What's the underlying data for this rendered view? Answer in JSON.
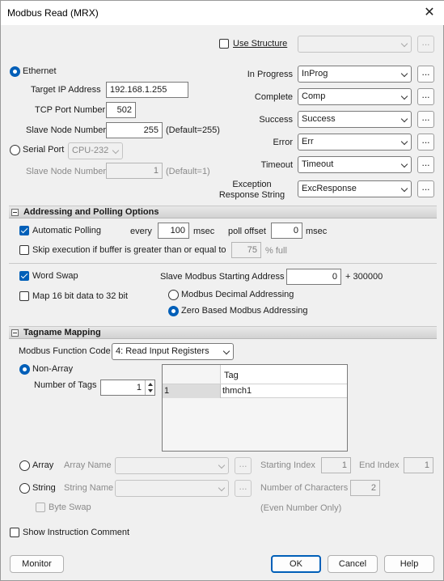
{
  "window": {
    "title": "Modbus Read (MRX)",
    "close_glyph": "✕"
  },
  "structure": {
    "use_label": "Use Structure",
    "value": ""
  },
  "ethernet": {
    "label": "Ethernet",
    "target_ip_label": "Target IP Address",
    "target_ip": "192.168.1.255",
    "tcp_port_label": "TCP Port Number",
    "tcp_port": "502",
    "slave_node_label": "Slave Node Number",
    "slave_node": "255",
    "slave_default": "(Default=255)"
  },
  "serial": {
    "label": "Serial Port",
    "port": "CPU-232",
    "slave_node_label": "Slave Node Number",
    "slave_node": "1",
    "slave_default": "(Default=1)"
  },
  "status_bits": [
    {
      "label": "In Progress",
      "value": "InProg"
    },
    {
      "label": "Complete",
      "value": "Comp"
    },
    {
      "label": "Success",
      "value": "Success"
    },
    {
      "label": "Error",
      "value": "Err"
    },
    {
      "label": "Timeout",
      "value": "Timeout"
    },
    {
      "label": "Exception\nResponse String",
      "value": "ExcResponse"
    }
  ],
  "addressing": {
    "section_title": "Addressing and Polling Options",
    "auto_polling_label": "Automatic Polling",
    "every_label": "every",
    "every_value": "100",
    "every_unit": "msec",
    "poll_offset_label": "poll offset",
    "poll_offset_value": "0",
    "poll_offset_unit": "msec",
    "skip_label": "Skip execution if buffer is greater than or equal to",
    "skip_value": "75",
    "skip_unit": "% full",
    "word_swap_label": "Word Swap",
    "map_label": "Map 16 bit data to 32 bit",
    "slave_start_label": "Slave Modbus Starting Address",
    "slave_start_value": "0",
    "slave_start_suffix": "+ 300000",
    "decimal_label": "Modbus Decimal Addressing",
    "zero_based_label": "Zero Based Modbus Addressing"
  },
  "tagname": {
    "section_title": "Tagname Mapping",
    "function_code_label": "Modbus Function Code",
    "function_code": "4: Read Input Registers",
    "non_array_label": "Non-Array",
    "num_tags_label": "Number of Tags",
    "num_tags": "1",
    "grid_header": "Tag",
    "grid_row_index": "1",
    "grid_row_tag": "thmch1",
    "array_label": "Array",
    "array_name_label": "Array Name",
    "starting_index_label": "Starting Index",
    "starting_index": "1",
    "end_index_label": "End Index",
    "end_index": "1",
    "string_label": "String",
    "string_name_label": "String Name",
    "num_chars_label": "Number of Characters",
    "num_chars": "2",
    "byte_swap_label": "Byte Swap",
    "even_only": "(Even Number Only)"
  },
  "footer": {
    "show_comment_label": "Show Instruction Comment",
    "monitor": "Monitor",
    "ok": "OK",
    "cancel": "Cancel",
    "help": "Help"
  },
  "dots_label": "...",
  "colors": {
    "accent": "#005fb8",
    "section_bg": "#dcdcdc"
  },
  "icons": [
    "close-icon",
    "chevron-down-icon",
    "ellipsis-icon",
    "collapse-icon",
    "spin-up-icon",
    "spin-down-icon"
  ]
}
